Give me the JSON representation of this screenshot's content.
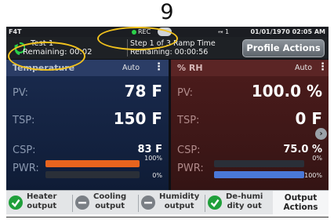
{
  "page_number": "9",
  "status_bar": {
    "model": "F4T",
    "rec": "REC",
    "usb": "1",
    "datetime": "01/01/1970 02:05 AM"
  },
  "header": {
    "profile_name": "Test 1",
    "profile_remaining": "Remaining: 00:02",
    "step_text": "Step 1 of 3 Ramp Time",
    "step_remaining": "Remaining: 00:00:56",
    "profile_actions_label": "Profile Actions"
  },
  "panels": {
    "temperature": {
      "title": "Temperature",
      "mode": "Auto",
      "pv_label": "PV:",
      "pv_value": "78 F",
      "tsp_label": "TSP:",
      "tsp_value": "150 F",
      "csp_label": "CSP:",
      "csp_value": "83 F",
      "pwr_label": "PWR:",
      "pwr_top_pct": "100%",
      "pwr_bottom_pct": "0%",
      "pwr_top_fill": 1.0,
      "pwr_bottom_fill": 0.0,
      "pwr_top_color": "#e8641e"
    },
    "humidity": {
      "title": "% RH",
      "mode": "Auto",
      "pv_label": "PV:",
      "pv_value": "100.0 %",
      "tsp_label": "TSP:",
      "tsp_value": "0 F",
      "csp_label": "CSP:",
      "csp_value": "75.0 %",
      "pwr_label": "PWR:",
      "pwr_top_pct": "0%",
      "pwr_bottom_pct": "100%",
      "pwr_top_fill": 0.0,
      "pwr_bottom_fill": 1.0,
      "pwr_bottom_color": "#4a78d8"
    }
  },
  "outputs": [
    {
      "line1": "Heater",
      "line2": "output",
      "state": "on"
    },
    {
      "line1": "Cooling",
      "line2": "output",
      "state": "off"
    },
    {
      "line1": "Humidity",
      "line2": "output",
      "state": "off"
    },
    {
      "line1": "De-humi",
      "line2": "dity out",
      "state": "on"
    }
  ],
  "output_actions": {
    "line1": "Output",
    "line2": "Actions"
  },
  "colors": {
    "annotation": "#f2c21d",
    "status_on": "#1f9f3a",
    "status_off": "#7a7f85"
  }
}
